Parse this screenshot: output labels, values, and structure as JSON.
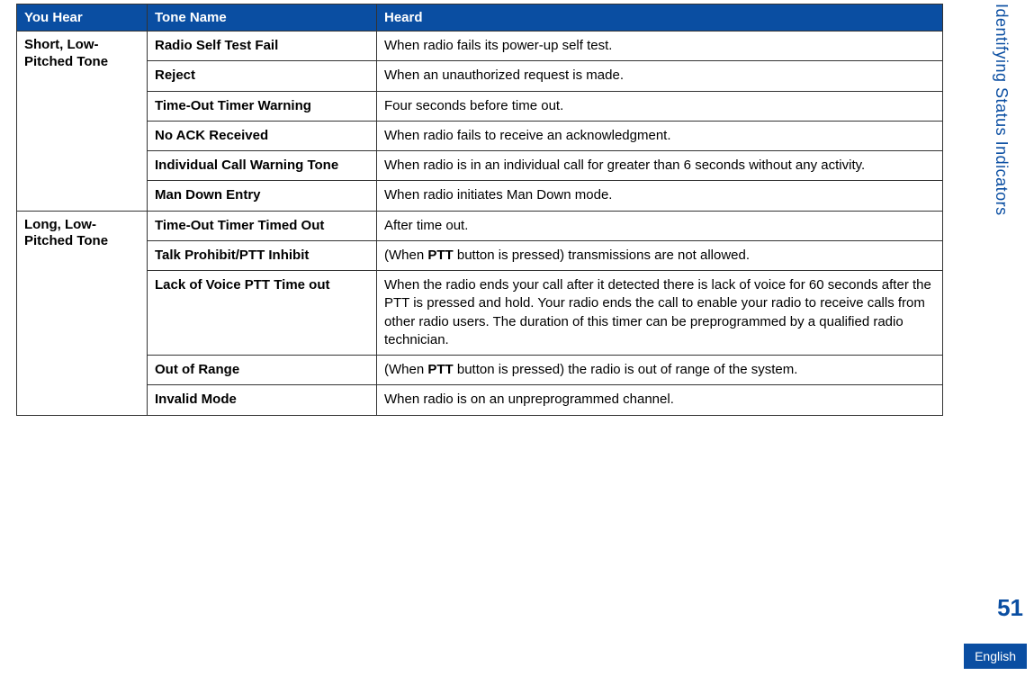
{
  "sidebar_title": "Identifying Status Indicators",
  "page_number": "51",
  "language": "English",
  "headers": {
    "you_hear": "You Hear",
    "tone_name": "Tone Name",
    "heard": "Heard"
  },
  "groups": [
    {
      "you_hear": "Short, Low-Pitched Tone",
      "rows": [
        {
          "tone_name": "Radio Self Test Fail",
          "heard_html": "When radio fails its power-up self test."
        },
        {
          "tone_name": "Reject",
          "heard_html": "When an unauthorized request is made."
        },
        {
          "tone_name": "Time-Out Timer Warning",
          "heard_html": "Four seconds before time out."
        },
        {
          "tone_name": "No ACK Received",
          "heard_html": "When radio fails to receive an acknowledgment."
        },
        {
          "tone_name": "Individual Call Warning Tone",
          "heard_html": "When radio is in an individual call for greater than 6 seconds without any activity."
        },
        {
          "tone_name": "Man Down Entry",
          "heard_html": "When radio initiates Man Down mode."
        }
      ]
    },
    {
      "you_hear": "Long, Low-Pitched Tone",
      "rows": [
        {
          "tone_name": "Time-Out Timer Timed Out",
          "heard_html": "After time out."
        },
        {
          "tone_name": "Talk Prohibit/PTT Inhibit",
          "heard_html": "(When <b>PTT</b> button is pressed) transmissions are not allowed."
        },
        {
          "tone_name": "Lack of Voice PTT Time out",
          "heard_html": "When the radio ends your call after it detected there is lack of voice for 60 seconds after the PTT is pressed and hold. Your radio ends the call to enable your radio to receive calls from other radio users. The duration of this timer can be preprogrammed by a qualified radio technician."
        },
        {
          "tone_name": "Out of Range",
          "heard_html": "(When <b>PTT</b> button is pressed) the radio is out of range of the system."
        },
        {
          "tone_name": "Invalid Mode",
          "heard_html": "When radio is on an unpreprogrammed channel."
        }
      ]
    }
  ]
}
